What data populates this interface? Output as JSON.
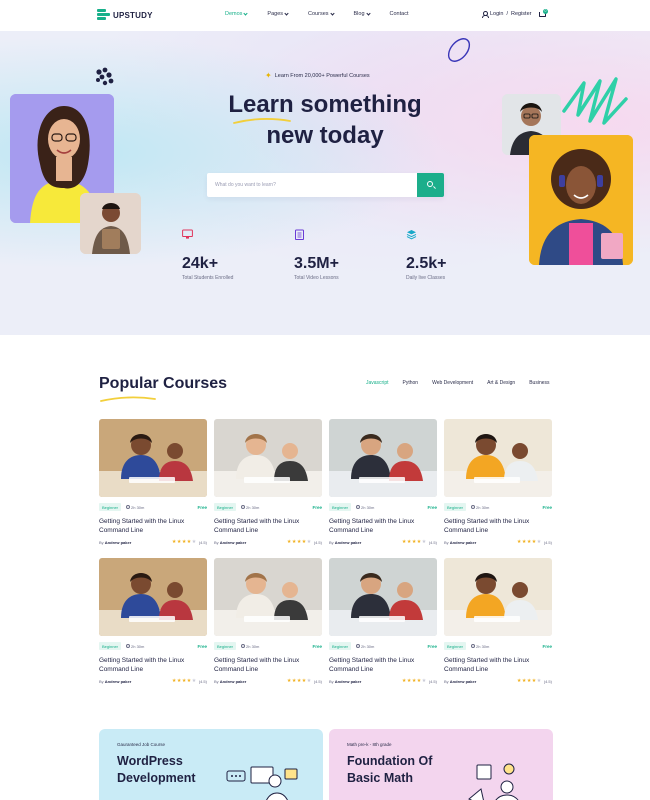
{
  "nav": {
    "brand": "UPSTUDY",
    "menu": [
      {
        "label": "Demos",
        "active": true
      },
      {
        "label": "Pages",
        "active": false
      },
      {
        "label": "Courses",
        "active": false
      },
      {
        "label": "Blog",
        "active": false
      },
      {
        "label": "Contact",
        "active": false
      }
    ],
    "login": "Login",
    "separator": "/",
    "register": "Register",
    "cart_count": "0"
  },
  "hero": {
    "tagline": "Learn From 20,000+ Powerful Courses",
    "title_line1": "Learn something",
    "title_line2": "new today",
    "search_placeholder": "What do you want to learn?",
    "stats": [
      {
        "value": "24k+",
        "label": "Total Students Enrolled",
        "icon": "monitor-icon"
      },
      {
        "value": "3.5M+",
        "label": "Total Video Lessons",
        "icon": "clipboard-icon"
      },
      {
        "value": "2.5k+",
        "label": "Daily live Classes",
        "icon": "layers-icon"
      }
    ]
  },
  "popular": {
    "title": "Popular Courses",
    "filters": [
      {
        "label": "Javascript",
        "active": true
      },
      {
        "label": "Python",
        "active": false
      },
      {
        "label": "Web Development",
        "active": false
      },
      {
        "label": "Art & Design",
        "active": false
      },
      {
        "label": "Business",
        "active": false
      }
    ],
    "courses": [
      {
        "level": "Beginner",
        "duration": "2h 30m",
        "price": "Free",
        "title": "Getting Started with the Linux Command Line",
        "by": "By",
        "author": "Andrew paker",
        "rating": "(4.5)",
        "stars": 3.5
      },
      {
        "level": "Beginner",
        "duration": "2h 30m",
        "price": "Free",
        "title": "Getting Started with the Linux Command Line",
        "by": "By",
        "author": "Andrew paker",
        "rating": "(4.5)",
        "stars": 3.5
      },
      {
        "level": "Beginner",
        "duration": "2h 30m",
        "price": "Free",
        "title": "Getting Started with the Linux Command Line",
        "by": "By",
        "author": "Andrew paker",
        "rating": "(4.5)",
        "stars": 3.5
      },
      {
        "level": "Beginner",
        "duration": "2h 30m",
        "price": "Free",
        "title": "Getting Started with the Linux Command Line",
        "by": "By",
        "author": "Andrew paker",
        "rating": "(4.5)",
        "stars": 3.5
      },
      {
        "level": "Beginner",
        "duration": "2h 30m",
        "price": "Free",
        "title": "Getting Started with the Linux Command Line",
        "by": "By",
        "author": "Andrew paker",
        "rating": "(4.5)",
        "stars": 3.5
      },
      {
        "level": "Beginner",
        "duration": "2h 30m",
        "price": "Free",
        "title": "Getting Started with the Linux Command Line",
        "by": "By",
        "author": "Andrew paker",
        "rating": "(4.5)",
        "stars": 3.5
      },
      {
        "level": "Beginner",
        "duration": "2h 30m",
        "price": "Free",
        "title": "Getting Started with the Linux Command Line",
        "by": "By",
        "author": "Andrew paker",
        "rating": "(4.5)",
        "stars": 3.5
      },
      {
        "level": "Beginner",
        "duration": "2h 30m",
        "price": "Free",
        "title": "Getting Started with the Linux Command Line",
        "by": "By",
        "author": "Andrew paker",
        "rating": "(4.5)",
        "stars": 3.5
      }
    ]
  },
  "promos": [
    {
      "kicker": "Gauranteed Job Course",
      "title": "WordPress Development",
      "color": "#c9ebf6"
    },
    {
      "kicker": "Math pre-k - 8th grade",
      "title": "Foundation Of Basic Math",
      "color": "#f3d5ee"
    }
  ],
  "colors": {
    "accent": "#17b08a",
    "heading": "#1f2142",
    "star": "#f2b01e"
  }
}
